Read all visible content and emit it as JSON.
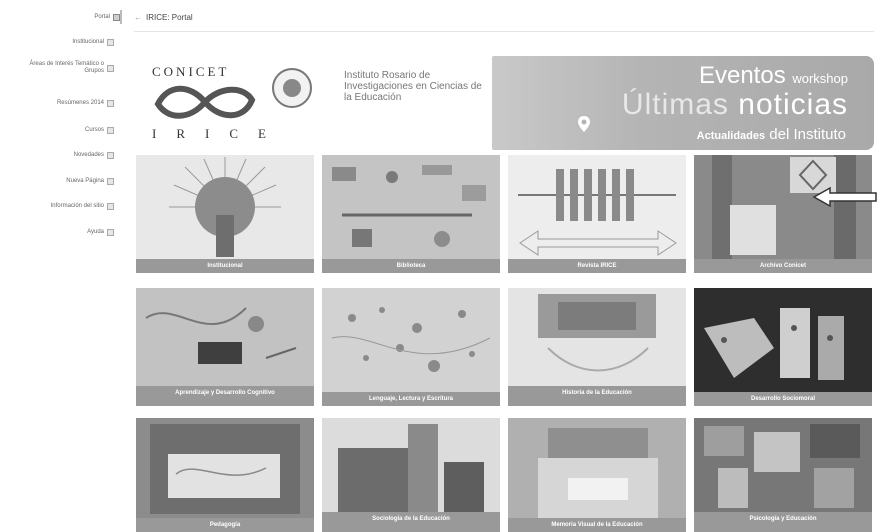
{
  "sidebar": {
    "items": [
      {
        "label": "Portal"
      },
      {
        "label": "Institucional"
      },
      {
        "label": "Áreas de Interés Temático o Grupos"
      },
      {
        "label": "Resúmenes 2014"
      },
      {
        "label": "Cursos"
      },
      {
        "label": "Novedades"
      },
      {
        "label": "Nueva Página"
      },
      {
        "label": "Información del sitio"
      },
      {
        "label": "Ayuda"
      }
    ]
  },
  "breadcrumb": {
    "home_icon": "arrow-left-icon",
    "text": "IRICE: Portal"
  },
  "banner": {
    "conicet": "CONICET",
    "irice": "IRICE",
    "institute": "Instituto Rosario de Investigaciones en Ciencias de la Educación",
    "eventos": "Eventos",
    "workshop": "workshop",
    "ultimas": "Últimas",
    "noticias": "noticias",
    "actualidades": "Actualidades",
    "del_instituto": "del Instituto"
  },
  "tiles": [
    {
      "label": "Institucional"
    },
    {
      "label": "Biblioteca"
    },
    {
      "label": "Revista IRICE"
    },
    {
      "label": "Archivo Conicet"
    },
    {
      "label": "Aprendizaje y Desarrollo Cognitivo"
    },
    {
      "label": "Lenguaje, Lectura y Escritura"
    },
    {
      "label": "Historia de la Educación"
    },
    {
      "label": "Desarrollo Sociomoral"
    },
    {
      "label": "Pedagogía"
    },
    {
      "label": "Sociología de la Educación"
    },
    {
      "label": "Memoria Visual de la Educación"
    },
    {
      "label": "Psicología y Educación"
    }
  ],
  "colors": {
    "tile_label_bg": "#999999",
    "banner_bg": "#b4b4b4"
  }
}
